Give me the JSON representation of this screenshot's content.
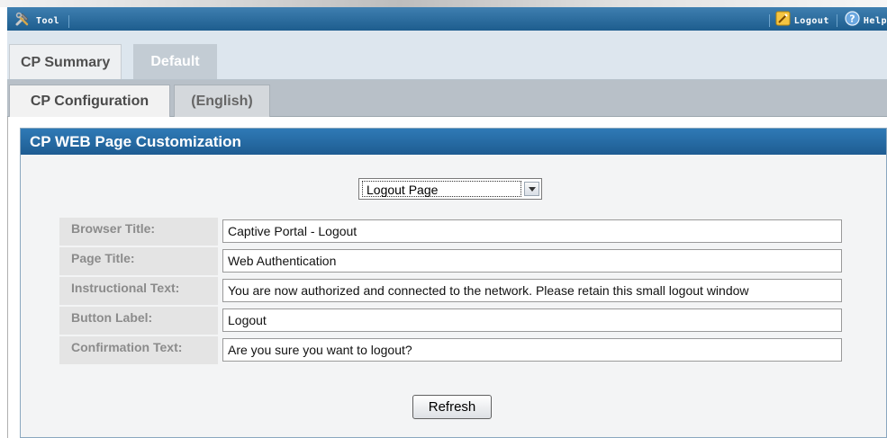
{
  "toolbar": {
    "tool_label": "Tool",
    "logout_label": "Logout",
    "help_label": "Help"
  },
  "tabs_primary": [
    {
      "label": "CP Summary",
      "selected": false
    },
    {
      "label": "Default",
      "selected": true
    }
  ],
  "tabs_secondary": [
    {
      "label": "CP Configuration",
      "selected": true
    },
    {
      "label": "(English)",
      "selected": false
    }
  ],
  "panel": {
    "title": "CP WEB Page Customization",
    "page_select": {
      "value": "Logout Page"
    },
    "fields": [
      {
        "label": "Browser Title:",
        "value": "Captive Portal - Logout"
      },
      {
        "label": "Page Title:",
        "value": "Web Authentication"
      },
      {
        "label": "Instructional Text:",
        "value": "You are now authorized and connected to the network. Please retain this small logout window"
      },
      {
        "label": "Button Label:",
        "value": "Logout"
      },
      {
        "label": "Confirmation Text:",
        "value": "Are you sure you want to logout?"
      }
    ],
    "refresh_label": "Refresh"
  },
  "colors": {
    "header_blue": "#1e5c92",
    "tab_selected": "#c3ccd4"
  },
  "icons": {
    "tool": "wrench-hammer-icon",
    "logout": "pencil-key-icon",
    "help": "question-globe-icon"
  }
}
